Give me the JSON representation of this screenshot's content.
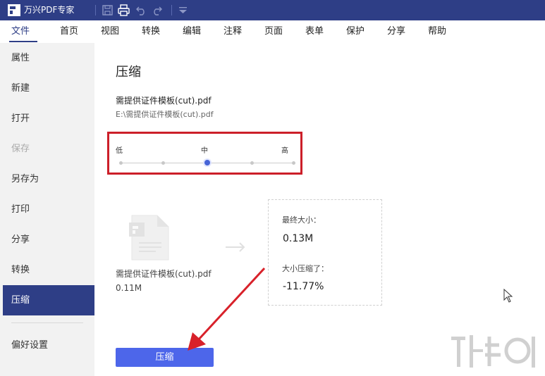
{
  "app": {
    "title": "万兴PDF专家",
    "accent_color": "#2e3e86",
    "toolbar_icons": [
      "save-icon",
      "print-icon",
      "undo-icon",
      "redo-icon",
      "dropdown-icon"
    ]
  },
  "menu": {
    "items": [
      "文件",
      "首页",
      "视图",
      "转换",
      "编辑",
      "注释",
      "页面",
      "表单",
      "保护",
      "分享",
      "帮助"
    ],
    "active": "文件"
  },
  "sidebar": {
    "items": [
      {
        "label": "属性",
        "state": "normal"
      },
      {
        "label": "新建",
        "state": "normal"
      },
      {
        "label": "打开",
        "state": "normal"
      },
      {
        "label": "保存",
        "state": "disabled"
      },
      {
        "label": "另存为",
        "state": "normal"
      },
      {
        "label": "打印",
        "state": "normal"
      },
      {
        "label": "分享",
        "state": "normal"
      },
      {
        "label": "转换",
        "state": "normal"
      },
      {
        "label": "压缩",
        "state": "active"
      }
    ],
    "preferences": "偏好设置"
  },
  "main": {
    "title": "压缩",
    "file_name": "需提供证件模板(cut).pdf",
    "file_path": "E:\\需提供证件模板(cut).pdf",
    "levels": {
      "low": "低",
      "mid": "中",
      "high": "高",
      "selected": "中"
    },
    "original": {
      "name": "需提供证件模板(cut).pdf",
      "size": "0.11M"
    },
    "result": {
      "final_label": "最终大小：",
      "final_value": "0.13M",
      "ratio_label": "大小压缩了：",
      "ratio_value": "-11.77%"
    },
    "compress_button": "压缩"
  }
}
